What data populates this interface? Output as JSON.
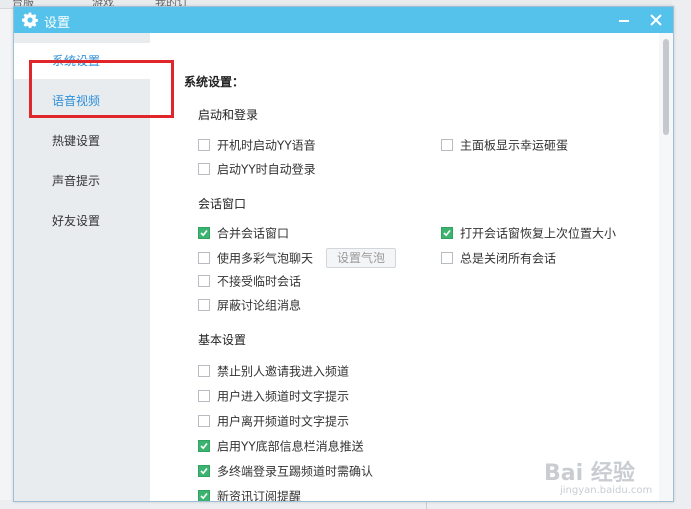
{
  "background": {
    "top_labels": [
      "台服",
      "游戏",
      "我的订"
    ]
  },
  "window": {
    "title": "设置",
    "title_bar_color": "#55c2ec"
  },
  "sidebar": {
    "items": [
      {
        "label": "系统设置"
      },
      {
        "label": "语音视频"
      },
      {
        "label": "热键设置"
      },
      {
        "label": "声音提示"
      },
      {
        "label": "好友设置"
      }
    ]
  },
  "content": {
    "title": "系统设置：",
    "sections": [
      {
        "heading": "启动和登录",
        "options": [
          {
            "label": "开机时启动YY语音",
            "checked": false
          },
          {
            "label": "主面板显示幸运砸蛋",
            "checked": false
          },
          {
            "label": "启动YY时自动登录",
            "checked": false
          }
        ]
      },
      {
        "heading": "会话窗口",
        "options": [
          {
            "label": "合并会话窗口",
            "checked": true
          },
          {
            "label": "打开会话窗恢复上次位置大小",
            "checked": true
          },
          {
            "label": "使用多彩气泡聊天",
            "checked": false
          },
          {
            "label": "总是关闭所有会话",
            "checked": false
          },
          {
            "label": "不接受临时会话",
            "checked": false
          },
          {
            "label": "屏蔽讨论组消息",
            "checked": false
          }
        ],
        "button": "设置气泡"
      },
      {
        "heading": "基本设置",
        "options": [
          {
            "label": "禁止别人邀请我进入频道",
            "checked": false
          },
          {
            "label": "用户进入频道时文字提示",
            "checked": false
          },
          {
            "label": "用户离开频道时文字提示",
            "checked": false
          },
          {
            "label": "启用YY底部信息栏消息推送",
            "checked": true
          },
          {
            "label": "多终端登录互踢频道时需确认",
            "checked": true
          },
          {
            "label": "新资讯订阅提醒",
            "checked": true
          }
        ]
      }
    ]
  },
  "watermark": {
    "brand": "Bai 经验",
    "url": "jingyan.baidu.com"
  },
  "colors": {
    "accent": "#2c8fd9",
    "checked": "#3cb371",
    "highlight_box": "#e0262a"
  }
}
